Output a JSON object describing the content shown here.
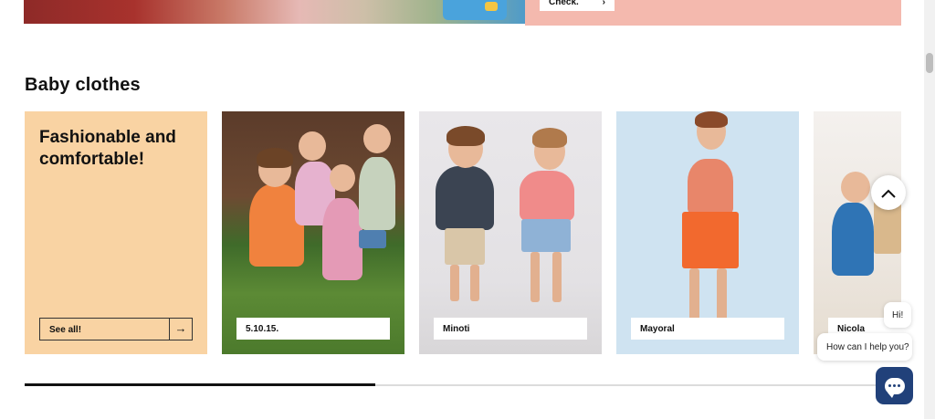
{
  "top_banner": {
    "button_label": "Check.",
    "button_arrow": "›"
  },
  "section": {
    "title": "Baby clothes"
  },
  "promo": {
    "title": "Fashionable and comfortable!",
    "see_all_label": "See all!",
    "see_all_arrow": "→"
  },
  "brands": [
    {
      "label": "5.10.15."
    },
    {
      "label": "Minoti"
    },
    {
      "label": "Mayoral"
    },
    {
      "label": "Nicola"
    }
  ],
  "carousel": {
    "progress": 0.4
  },
  "scroll_top": {
    "icon": "chevron-up-icon",
    "glyph": "⌃"
  },
  "chat": {
    "greeting": "Hi!",
    "prompt": "How can I help you?",
    "icon": "chat-icon"
  },
  "colors": {
    "promo_bg": "#f9d3a3",
    "top_promo_bg": "#f4b9ae",
    "chat_button": "#21417a"
  }
}
